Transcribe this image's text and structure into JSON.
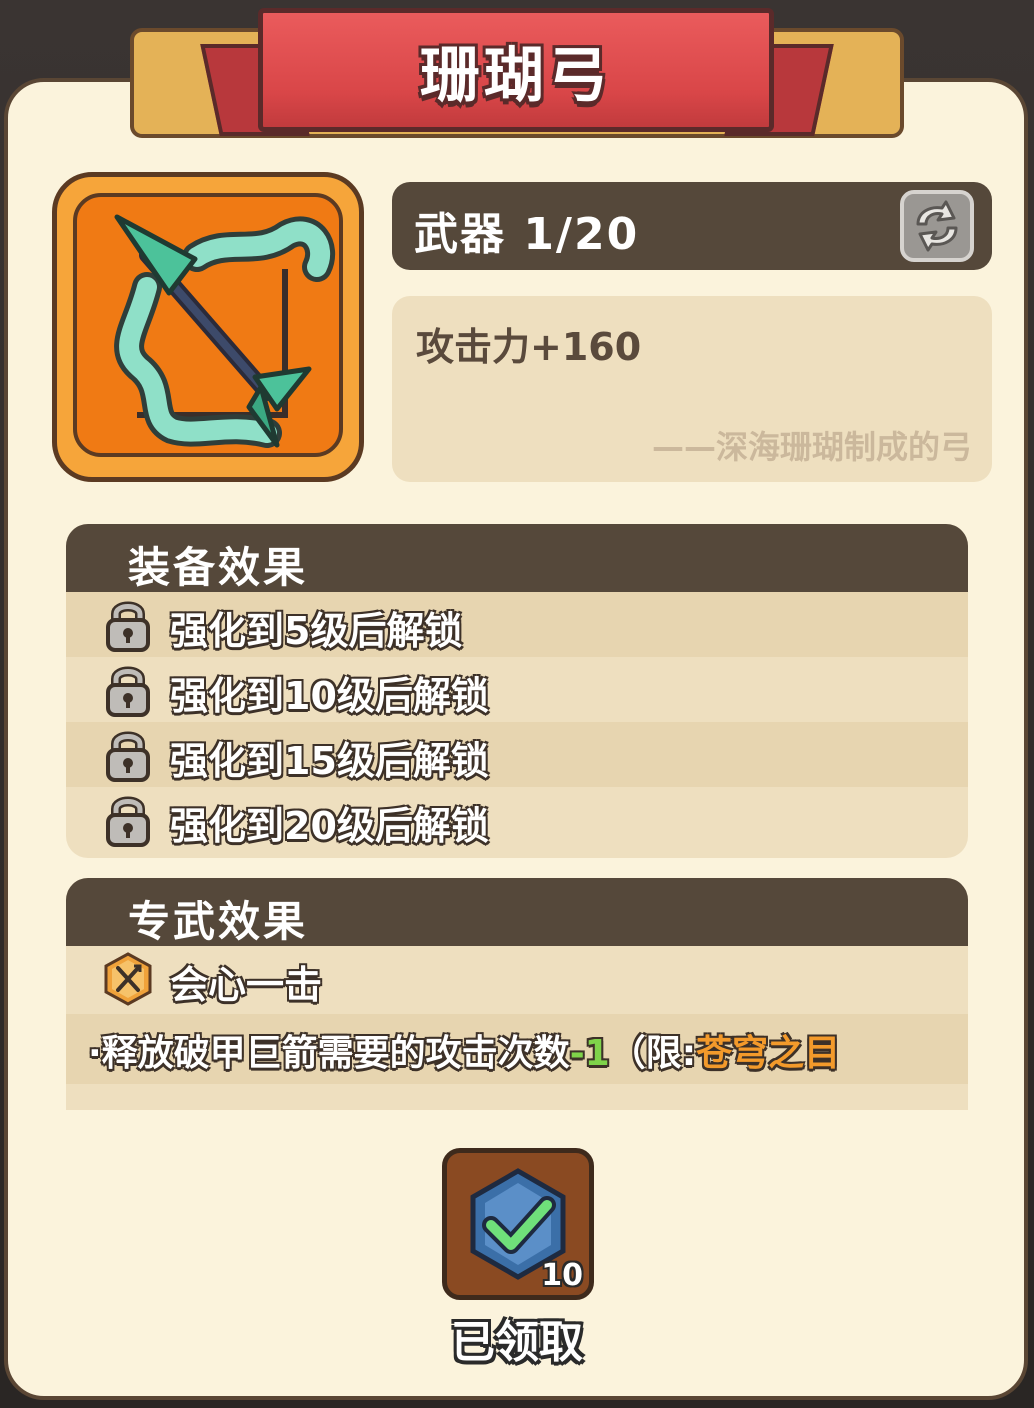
{
  "header": {
    "title": "珊瑚弓"
  },
  "item": {
    "icon": "coral-bow-icon",
    "type_level": "武器 1/20",
    "refresh_icon": "refresh-icon",
    "stat": "攻击力+160",
    "flavor": "——深海珊瑚制成的弓"
  },
  "equip_effects": {
    "title": "装备效果",
    "rows": [
      {
        "icon": "lock-icon",
        "text": "强化到5级后解锁"
      },
      {
        "icon": "lock-icon",
        "text": "强化到10级后解锁"
      },
      {
        "icon": "lock-icon",
        "text": "强化到15级后解锁"
      },
      {
        "icon": "lock-icon",
        "text": "强化到20级后解锁"
      }
    ]
  },
  "exclusive_effects": {
    "title": "专武效果",
    "skill_icon": "crossed-arrows-hex-icon",
    "skill_name": "会心一击",
    "desc_prefix": "·释放破甲巨箭需要的攻击次数",
    "desc_value": "-1",
    "desc_middle": "（限:",
    "desc_limit": "苍穹之目"
  },
  "reward": {
    "icon": "checkmark-gem-icon",
    "count": "10",
    "status": "已领取"
  },
  "colors": {
    "panel_bg": "#fbf3dc",
    "header_dark": "#55483a",
    "ribbon_red": "#d94648",
    "item_orange": "#f07a14",
    "accent_green": "#7fd34a",
    "accent_orange": "#f39a2b"
  }
}
